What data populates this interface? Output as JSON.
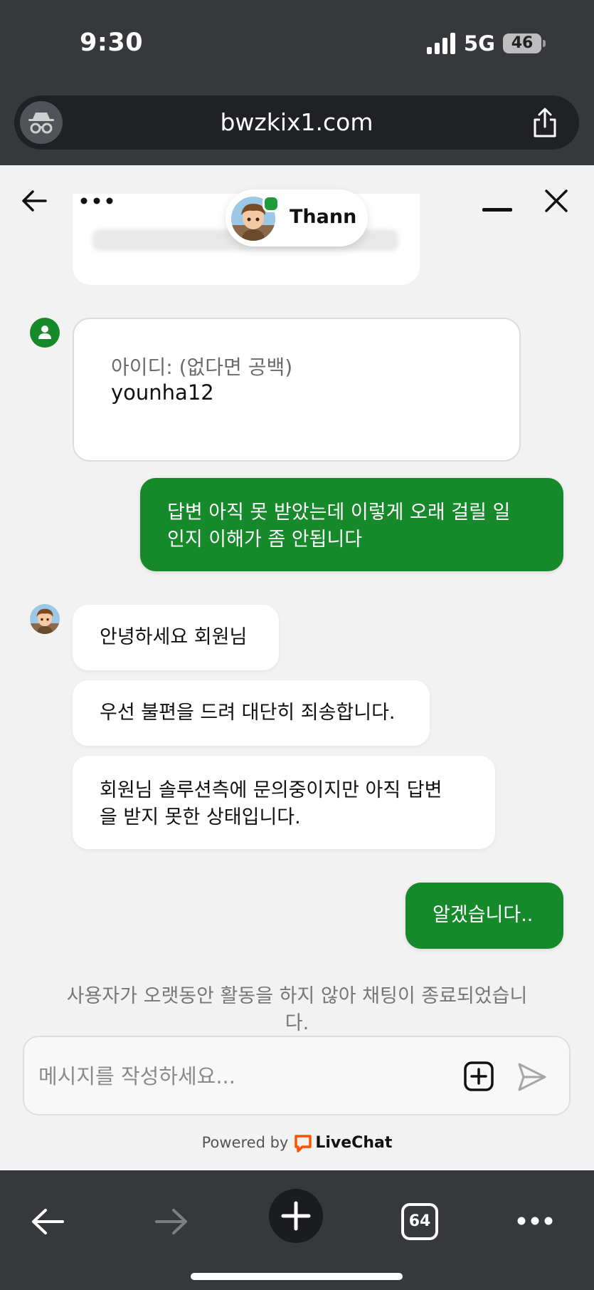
{
  "status_bar": {
    "time": "9:30",
    "network": "5G",
    "battery": "46"
  },
  "browser": {
    "url": "bwzkix1.com",
    "tab_count": "64"
  },
  "chat_header": {
    "agent_name": "Thann"
  },
  "pre_chat_form": {
    "label": "아이디: (없다면 공백)",
    "value": "younha12"
  },
  "messages": [
    {
      "from": "user",
      "lines": [
        "답변 아직 못 받았는데 이렇게 오래 걸릴 일",
        "인지 이해가 좀 안됩니다"
      ]
    },
    {
      "from": "agent",
      "lines": [
        "안녕하세요 회원님"
      ]
    },
    {
      "from": "agent",
      "lines": [
        "우선 불편을 드려 대단히 죄송합니다."
      ]
    },
    {
      "from": "agent",
      "lines": [
        "회원님 솔루션측에 문의중이지만 아직 답변",
        "을 받지 못한 상태입니다."
      ]
    },
    {
      "from": "user",
      "lines": [
        "알겠습니다.."
      ]
    }
  ],
  "system_message": {
    "lines": [
      "사용자가 오랫동안 활동을 하지 않아 채팅이 종료되었습니",
      "다."
    ]
  },
  "composer": {
    "placeholder": "메시지를 작성하세요..."
  },
  "footer": {
    "powered_by": "Powered by",
    "brand": "LiveChat"
  },
  "colors": {
    "accent_green": "#168a2a",
    "chrome_dark": "#36383c",
    "livechat_orange": "#ff5100"
  },
  "icons": [
    "incognito-icon",
    "share-icon",
    "back-arrow-icon",
    "more-options-icon",
    "minimize-icon",
    "close-icon",
    "user-icon",
    "attach-icon",
    "send-icon",
    "livechat-logo-icon",
    "forward-arrow-icon",
    "plus-icon",
    "tabs-icon"
  ]
}
